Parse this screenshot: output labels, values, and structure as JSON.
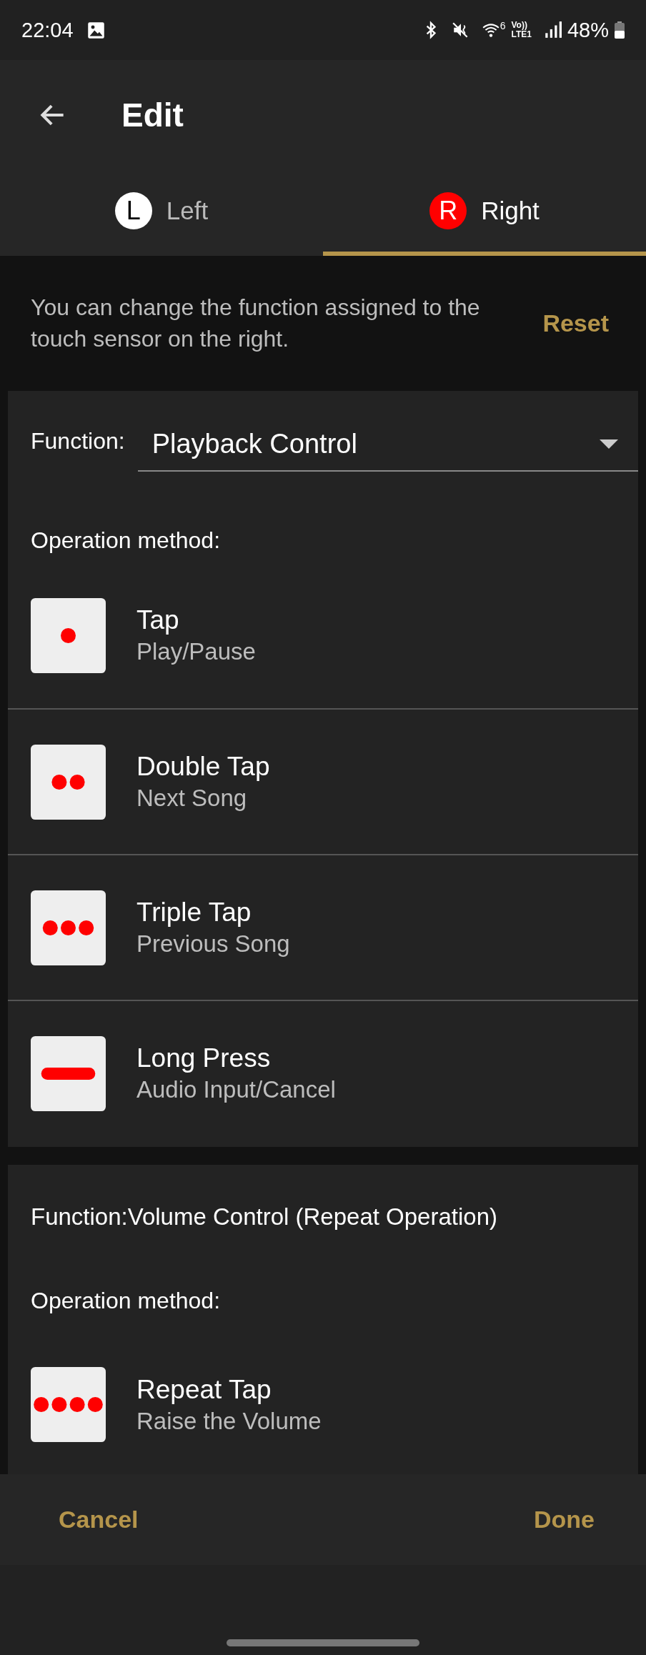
{
  "status_bar": {
    "time": "22:04",
    "wifi_badge": "6",
    "volte_top": "Vo))",
    "volte_bottom": "LTE1",
    "battery": "48%"
  },
  "app_bar": {
    "title": "Edit"
  },
  "tabs": [
    {
      "badge": "L",
      "label": "Left",
      "selected": false
    },
    {
      "badge": "R",
      "label": "Right",
      "selected": true
    }
  ],
  "description": "You can change the function assigned to the touch sensor on the right.",
  "reset_button": "Reset",
  "playback_card": {
    "function_label": "Function:",
    "function_value": "Playback Control",
    "method_label": "Operation method:",
    "items": [
      {
        "kind": "single",
        "title": "Tap",
        "action": "Play/Pause"
      },
      {
        "kind": "double",
        "title": "Double Tap",
        "action": "Next Song"
      },
      {
        "kind": "triple",
        "title": "Triple Tap",
        "action": "Previous Song"
      },
      {
        "kind": "long",
        "title": "Long Press",
        "action": "Audio Input/Cancel"
      }
    ]
  },
  "volume_card": {
    "function_text": "Function:Volume Control (Repeat Operation)",
    "method_label": "Operation method:",
    "items": [
      {
        "kind": "repeat",
        "title": "Repeat Tap",
        "action": "Raise the Volume"
      }
    ]
  },
  "buttons": {
    "cancel": "Cancel",
    "done": "Done"
  }
}
